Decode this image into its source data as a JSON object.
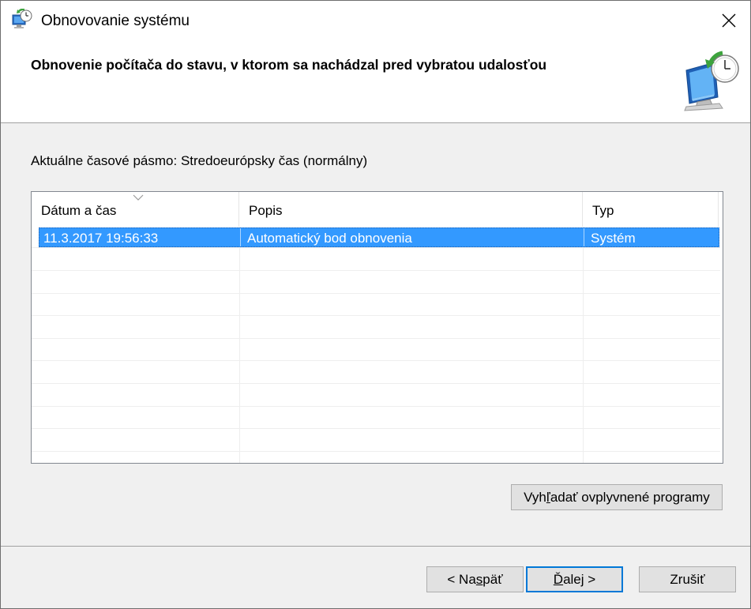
{
  "window": {
    "title": "Obnovovanie systému"
  },
  "header": {
    "title": "Obnovenie počítača do stavu, v ktorom sa nachádzal pred vybratou udalosťou"
  },
  "timezone": {
    "label": "Aktuálne časové pásmo: Stredoeurópsky čas (normálny)"
  },
  "list": {
    "columns": [
      "Dátum a čas",
      "Popis",
      "Typ"
    ],
    "sorted_column": "Dátum a čas",
    "rows": [
      {
        "date": "11.3.2017 19:56:33",
        "description": "Automatický bod obnovenia",
        "type": "Systém",
        "selected": true
      }
    ]
  },
  "buttons": {
    "scan": {
      "pre": "Vyh",
      "mnemonic": "ľ",
      "post": "adať ovplyvnené programy"
    },
    "back": {
      "pre": "< Na",
      "mnemonic": "s",
      "post": "päť"
    },
    "next": {
      "pre": "",
      "mnemonic": "Ď",
      "post": "alej >"
    },
    "cancel": {
      "label": "Zrušiť"
    }
  },
  "colors": {
    "selection": "#3399ff",
    "default_button_border": "#0078d7",
    "dialog_background": "#f0f0f0"
  },
  "icons": [
    "system-restore-icon",
    "close-icon",
    "sort-arrow-icon",
    "restore-computer-icon"
  ]
}
